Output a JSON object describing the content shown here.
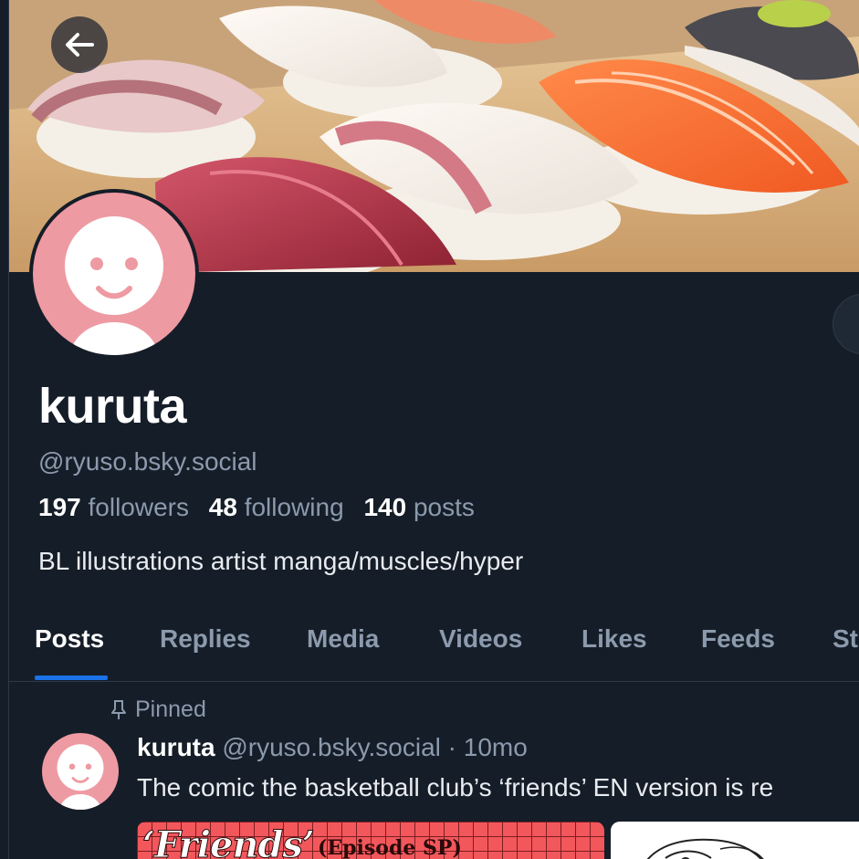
{
  "profile": {
    "display_name": "kuruta",
    "handle": "@ryuso.bsky.social",
    "followers_count": "197",
    "followers_label": "followers",
    "following_count": "48",
    "following_label": "following",
    "posts_count": "140",
    "posts_label": "posts",
    "bio": "BL illustrations artist manga/muscles/hyper"
  },
  "tabs": [
    {
      "label": "Posts",
      "active": true
    },
    {
      "label": "Replies"
    },
    {
      "label": "Media"
    },
    {
      "label": "Videos"
    },
    {
      "label": "Likes"
    },
    {
      "label": "Feeds"
    },
    {
      "label": "St"
    }
  ],
  "pinned_post": {
    "pinned_label": "Pinned",
    "author_name": "kuruta",
    "author_handle": "@ryuso.bsky.social",
    "separator": "·",
    "time": "10mo",
    "text": "The comic the basketball club’s ‘friends’ EN version is re",
    "image1_title": "‘Friends’",
    "image1_subtitle": "(Episode SP)"
  },
  "icons": {
    "back": "arrow-left-icon",
    "pin": "pin-icon"
  },
  "colors": {
    "background": "#151d28",
    "accent": "#1a73e8",
    "muted_text": "#8c9aad",
    "avatar_pink": "#ee9aa2"
  }
}
